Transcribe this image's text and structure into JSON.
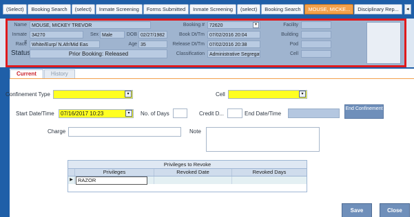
{
  "top_tabs": [
    {
      "label": "(Select)",
      "active": false
    },
    {
      "label": "Booking Search",
      "active": false
    },
    {
      "label": "(select)",
      "active": false
    },
    {
      "label": "Inmate Screening",
      "active": false
    },
    {
      "label": "Forms Submitted",
      "active": false
    },
    {
      "label": "Inmate Screening",
      "active": false
    },
    {
      "label": "(select)",
      "active": false
    },
    {
      "label": "Booking Search",
      "active": false
    },
    {
      "label": "MOUSE, MICKE...",
      "active": true
    },
    {
      "label": "Disciplinary Rep...",
      "active": false
    }
  ],
  "tab_scroll_glyph": "◂",
  "header": {
    "name_label": "Name",
    "name": "MOUSE, MICKEY TREVOR",
    "inmate_label": "Inmate #",
    "inmate": "34270",
    "sex_label": "Sex",
    "sex": "Male",
    "dob_label": "DOB",
    "dob": "02/27/1982",
    "race_label": "Race",
    "race": "White/Eurp/ N.Afr/Mid Eas",
    "age_label": "Age",
    "age": "35",
    "status_label": "Status",
    "status": "Prior Booking: Released",
    "booking_label": "Booking #",
    "booking": "72620",
    "bookdt_label": "Book Dt/Tm",
    "bookdt": "07/02/2016 20:04",
    "releasedt_label": "Release Dt/Tm",
    "releasedt": "07/02/2016 20:38",
    "class_label": "Classification",
    "classification": "Administrative Segregati",
    "facility_label": "Facility",
    "facility": "",
    "building_label": "Building",
    "building": "",
    "pod_label": "Pod",
    "pod": "",
    "cell_label": "Cell",
    "cell": ""
  },
  "sub_tabs": [
    {
      "label": "Current",
      "active": true
    },
    {
      "label": "History",
      "active": false
    }
  ],
  "form": {
    "confinement_type_label": "Confinement Type",
    "confinement_type": "",
    "cell_label": "Cell",
    "cell": "",
    "start_label": "Start Date/Time",
    "start": "07/16/2017 10:23",
    "days_label": "No. of Days",
    "days": "",
    "credit_label": "Credit D...",
    "credit": "",
    "end_label": "End Date/Time",
    "end": "",
    "end_button": "End Confinement",
    "charge_label": "Charge",
    "charge": "",
    "note_label": "Note",
    "note": ""
  },
  "privileges": {
    "title": "Privileges to Revoke",
    "columns": [
      "Privileges",
      "Revoked Date",
      "Revoked Days"
    ],
    "rows": [
      {
        "privilege": "RAZOR",
        "revoked_date": "",
        "revoked_days": ""
      }
    ],
    "row_indicator": "▶"
  },
  "dropdown_glyph": "▾",
  "actions": {
    "save": "Save",
    "close": "Close"
  },
  "colors": {
    "accent_tab": "#f3a04a",
    "header_border": "#e0191c",
    "required_field": "#ffff22",
    "frame_blue": "#1f5fa8"
  }
}
